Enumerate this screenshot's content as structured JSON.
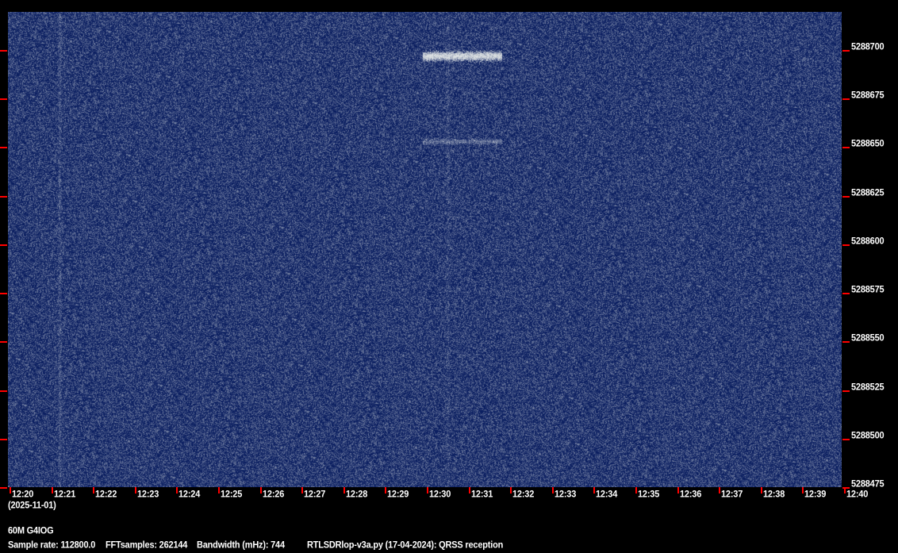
{
  "chart_data": {
    "type": "heatmap",
    "title": "60M G4IOG",
    "date_label": "(2025-11-01)",
    "x_ticks": [
      "12:20",
      "12:21",
      "12:22",
      "12:23",
      "12:24",
      "12:25",
      "12:26",
      "12:27",
      "12:28",
      "12:29",
      "12:30",
      "12:31",
      "12:32",
      "12:33",
      "12:34",
      "12:35",
      "12:36",
      "12:37",
      "12:38",
      "12:39",
      "12:40"
    ],
    "x_range_minutes": [
      0,
      20
    ],
    "y_ticks": [
      "5288700",
      "5288675",
      "5288650",
      "5288625",
      "5288600",
      "5288575",
      "5288550",
      "5288525",
      "5288500",
      "5288475"
    ],
    "y_range_hz": [
      5288475,
      5288719.6
    ],
    "colormap": {
      "background": "#0a2a6e",
      "noise": "#3a6fb0",
      "signal": "#d8dce0"
    },
    "signals": [
      {
        "start_min": 9.9,
        "end_min": 11.8,
        "freq_hz": 5288697,
        "intensity": 1.0
      },
      {
        "start_min": 9.9,
        "end_min": 11.8,
        "freq_hz": 5288653,
        "intensity": 0.35
      }
    ],
    "vertical_streaks": [
      {
        "at_min": 1.2,
        "intensity": 0.25
      },
      {
        "at_min": 10.5,
        "intensity": 0.15
      }
    ]
  },
  "footer": {
    "station": "60M G4IOG",
    "sample_rate": "Sample rate: 112800.0",
    "fft_samples": "FFTsamples: 262144",
    "bandwidth": "Bandwidth (mHz): 744",
    "software": "RTLSDRlop-v3a.py (17-04-2024): QRSS reception"
  }
}
